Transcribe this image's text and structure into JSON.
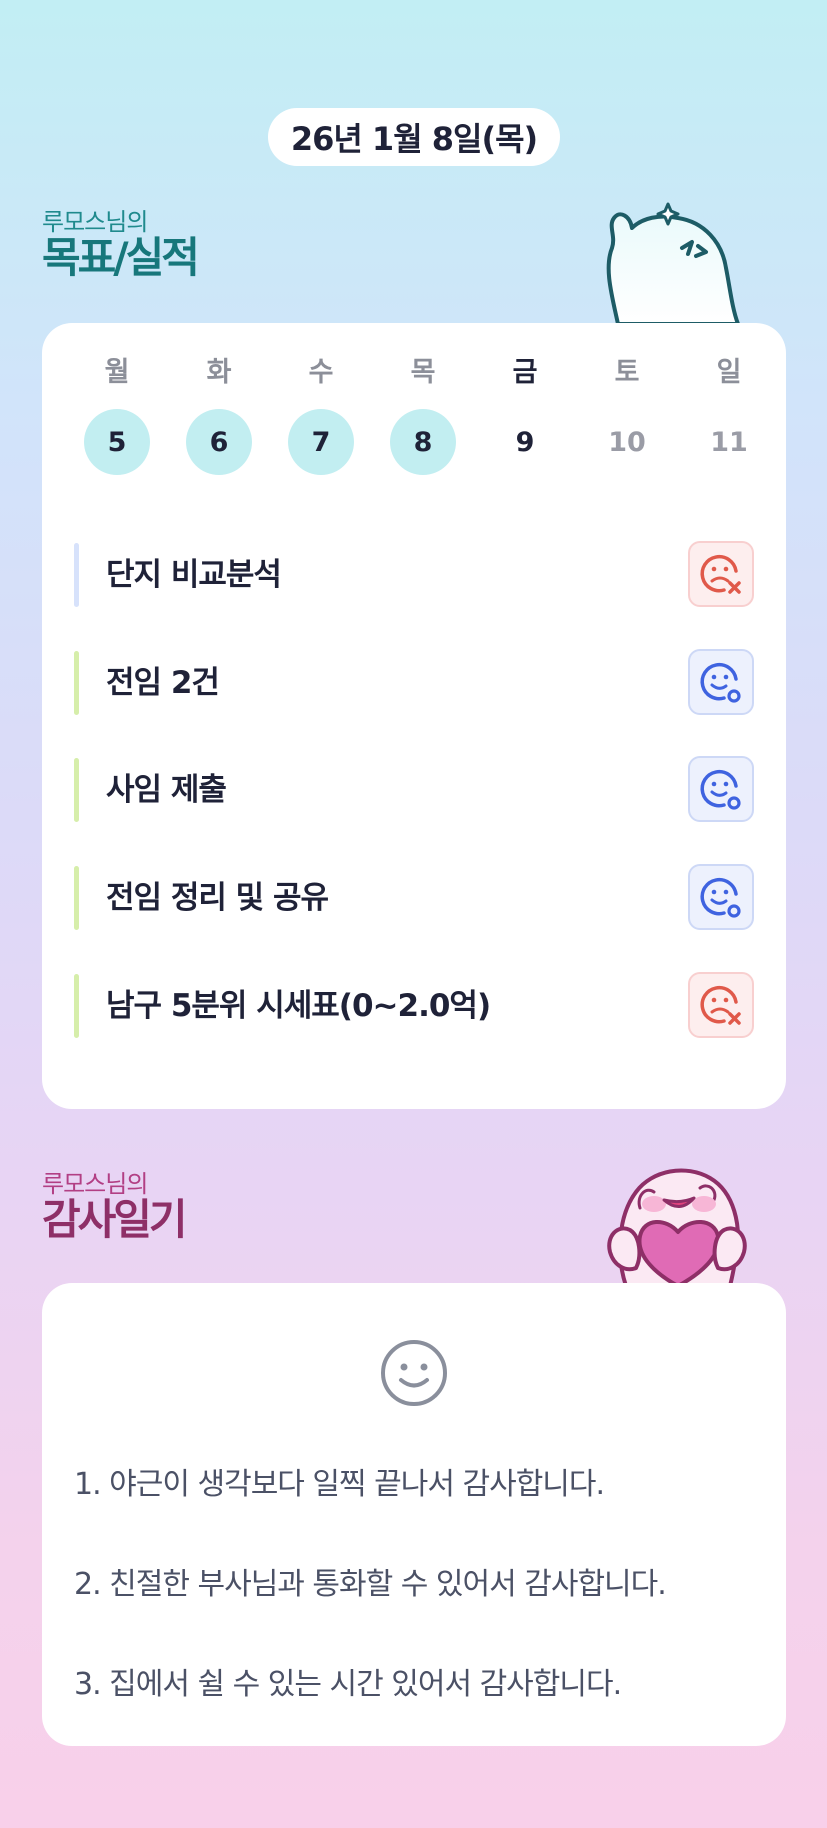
{
  "header": {
    "date": "26년 1월 8일(목)"
  },
  "goals": {
    "title_sub": "루모스님의",
    "title_main": "목표/실적",
    "week": [
      {
        "day": "월",
        "date": "5",
        "state": "done"
      },
      {
        "day": "화",
        "date": "6",
        "state": "done"
      },
      {
        "day": "수",
        "date": "7",
        "state": "done"
      },
      {
        "day": "목",
        "date": "8",
        "state": "done"
      },
      {
        "day": "금",
        "date": "9",
        "state": "today"
      },
      {
        "day": "토",
        "date": "10",
        "state": "future"
      },
      {
        "day": "일",
        "date": "11",
        "state": "future"
      }
    ],
    "items": [
      {
        "label": "단지 비교분석",
        "status": "fail",
        "bar_color": "#d7e2fb",
        "icon": "sad-face-x-icon"
      },
      {
        "label": "전임 2건",
        "status": "success",
        "bar_color": "#d6eeaa",
        "icon": "smile-face-o-icon"
      },
      {
        "label": "사임 제출",
        "status": "success",
        "bar_color": "#d6eeaa",
        "icon": "smile-face-o-icon"
      },
      {
        "label": "전임 정리 및 공유",
        "status": "success",
        "bar_color": "#d6eeaa",
        "icon": "smile-face-o-icon"
      },
      {
        "label": "남구 5분위 시세표(0~2.0억)",
        "status": "fail",
        "bar_color": "#d6eeaa",
        "icon": "sad-face-x-icon"
      }
    ]
  },
  "gratitude": {
    "title_sub": "루모스님의",
    "title_main": "감사일기",
    "icon": "smile-face-icon",
    "entries": [
      "1. 야근이 생각보다 일찍 끝나서 감사합니다.",
      "2. 친절한 부사님과 통화할 수 있어서 감사합니다.",
      "3. 집에서 쉴 수 있는 시간 있어서 감사합니다."
    ]
  },
  "colors": {
    "fail": "#e0594a",
    "success": "#3f63e0",
    "done_day": "#c2eef1"
  }
}
